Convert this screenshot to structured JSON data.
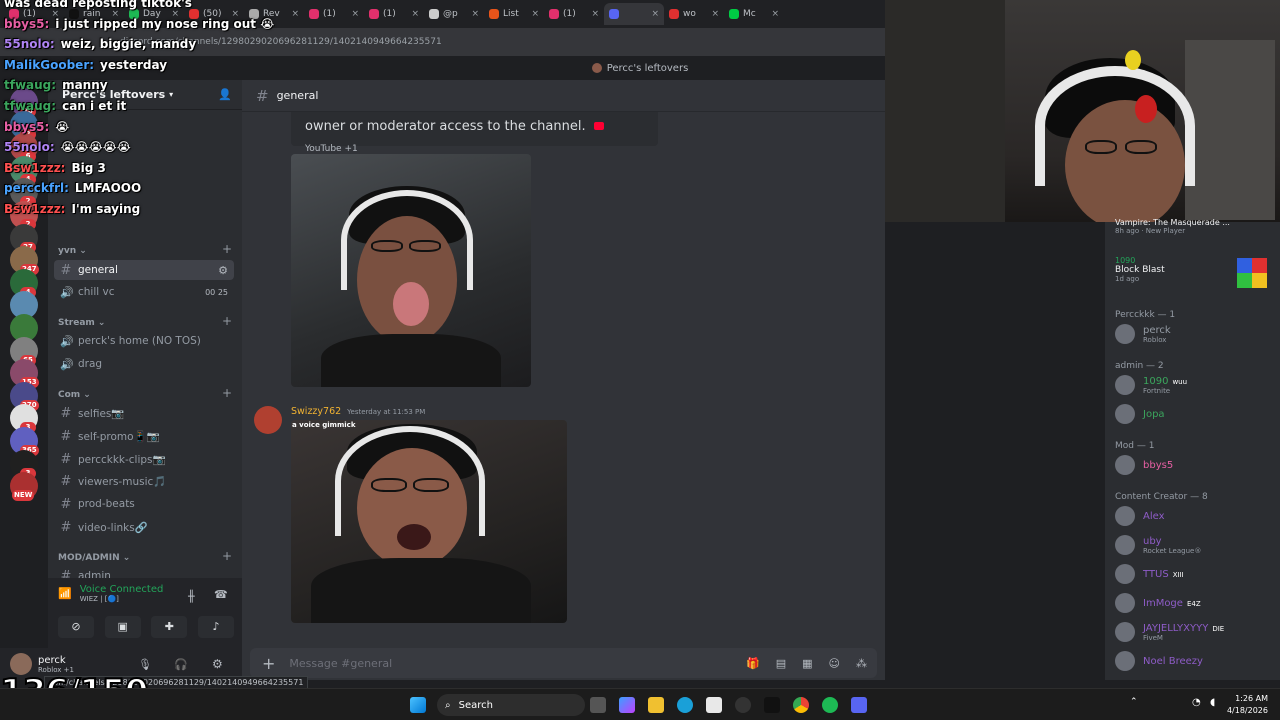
{
  "browser": {
    "tabs": [
      {
        "label": "(1)",
        "color": "#e1306c"
      },
      {
        "label": "rain",
        "color": "#111111"
      },
      {
        "label": "Day",
        "color": "#1db954"
      },
      {
        "label": "(50)",
        "color": "#e03030"
      },
      {
        "label": "Rev",
        "color": "#aaaaaa"
      },
      {
        "label": "(1)",
        "color": "#e1306c"
      },
      {
        "label": "(1)",
        "color": "#e1306c"
      },
      {
        "label": "@p",
        "color": "#cccccc"
      },
      {
        "label": "List",
        "color": "#e8541a"
      },
      {
        "label": "(1)",
        "color": "#e1306c"
      },
      {
        "label": "",
        "color": "#5865f2"
      },
      {
        "label": "wo",
        "color": "#e03030"
      },
      {
        "label": "Mc",
        "color": "#00cc44"
      }
    ],
    "url": "discord.com/channels/1298029020696281129/1402140949664235571"
  },
  "window_title": "Percc's leftovers",
  "servers": {
    "badges": [
      "20",
      "2",
      "6",
      "4",
      "2",
      "2",
      "27",
      "247",
      "4",
      "",
      "",
      "65",
      "153",
      "270",
      "3",
      "365",
      "3",
      "NEW"
    ]
  },
  "channels": {
    "server_name": "Percc's leftovers",
    "categories": {
      "yvn": "yvn",
      "stream": "Stream",
      "com": "Com",
      "mod": "MOD/ADMIN"
    },
    "items": [
      {
        "label": "general",
        "kind": "text",
        "selected": true
      },
      {
        "label": "chill vc",
        "kind": "voice",
        "right": "00  25"
      },
      {
        "label": "perck's home (NO TOS)",
        "kind": "voice"
      },
      {
        "label": "drag",
        "kind": "voice"
      },
      {
        "label": "selfies📷",
        "kind": "text"
      },
      {
        "label": "self-promo📱📷",
        "kind": "text"
      },
      {
        "label": "percckkk-clips📷",
        "kind": "text"
      },
      {
        "label": "viewers-music🎵",
        "kind": "text"
      },
      {
        "label": "prod-beats",
        "kind": "text"
      },
      {
        "label": "video-links🔗",
        "kind": "text"
      },
      {
        "label": "admin",
        "kind": "text"
      }
    ],
    "voice_connected": "Voice Connected",
    "voice_server": "WIEZ | [🔵]"
  },
  "user": {
    "name": "perck",
    "status": "Roblox +1"
  },
  "chat": {
    "channel_name": "general",
    "embed_text": "owner or moderator access to the channel.",
    "embed_source": "YouTube +1",
    "author": "Swizzy762",
    "timestamp": "Yesterday at 11:53 PM",
    "image_caption": "a voice gimmick",
    "composer_placeholder": "Message #general"
  },
  "members": {
    "top": [
      {
        "name": "Vampire: The Masquerade ...",
        "sub": "8h ago · New Player"
      },
      {
        "name": "1090",
        "game": "Block Blast",
        "sub": "1d ago"
      }
    ],
    "groups": [
      {
        "title": "Percckkk — 1",
        "members": [
          {
            "name": "perck",
            "sub": "Roblox",
            "color": "#949ba4"
          }
        ]
      },
      {
        "title": "admin — 2",
        "members": [
          {
            "name": "1090",
            "sub": "Fortnite",
            "color": "#3ba55d",
            "tag": "wuu"
          },
          {
            "name": "Jopa",
            "sub": "",
            "color": "#3ba55d"
          }
        ]
      },
      {
        "title": "Mod — 1",
        "members": [
          {
            "name": "bbys5",
            "sub": "",
            "color": "#e75fa4"
          }
        ]
      },
      {
        "title": "Content Creator — 8",
        "members": [
          {
            "name": "Alex",
            "sub": "",
            "color": "#8e5cc7"
          },
          {
            "name": "uby",
            "sub": "Rocket League®",
            "color": "#8e5cc7"
          },
          {
            "name": "TTUS",
            "sub": "",
            "color": "#8e5cc7",
            "tag": "XIII"
          },
          {
            "name": "ImMoge",
            "sub": "",
            "color": "#8e5cc7",
            "tag": "E4Z"
          },
          {
            "name": "JAYJELLYXYYY",
            "sub": "FiveM",
            "color": "#8e5cc7",
            "tag": "DIE"
          },
          {
            "name": "Noel Breezy",
            "sub": "",
            "color": "#8e5cc7"
          }
        ]
      }
    ]
  },
  "overlay": {
    "lines": [
      {
        "user": "",
        "text": "was dead reposting tiktok's",
        "color": "#ffffff"
      },
      {
        "user": "bbys5:",
        "text": "i just ripped my nose ring out 😭",
        "color": "#e75fa4"
      },
      {
        "user": "55nolo:",
        "text": "weiz, biggie, mandy",
        "color": "#b084f5"
      },
      {
        "user": "MalikGoober:",
        "text": "yesterday",
        "color": "#4aa3ff"
      },
      {
        "user": "tfwaug:",
        "text": "manny",
        "color": "#3ba55d"
      },
      {
        "user": "tfwaug:",
        "text": "can i et it",
        "color": "#3ba55d"
      },
      {
        "user": "bbys5:",
        "text": "😭",
        "color": "#e75fa4"
      },
      {
        "user": "55nolo:",
        "text": "😭😭😭😭😭",
        "color": "#b084f5"
      },
      {
        "user": "Bsw1zzz:",
        "text": "Big 3",
        "color": "#ff5050"
      },
      {
        "user": "percckfrl:",
        "text": "LMFAOOO",
        "color": "#4aa3ff"
      },
      {
        "user": "Bsw1zzz:",
        "text": "I'm saying",
        "color": "#ff5050"
      }
    ],
    "counter": "136/150",
    "status_url": "com/channels/1298029020696281129/1402140949664235571"
  },
  "taskbar": {
    "search": "Search",
    "time": "1:26 AM",
    "date": "4/18/2026"
  },
  "colors": {
    "accent": "#5865f2",
    "online": "#23a55a",
    "danger": "#da373c"
  }
}
